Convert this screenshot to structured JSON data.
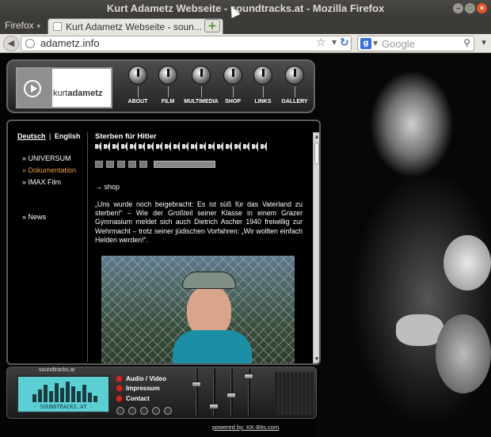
{
  "window": {
    "title": "Kurt Adametz Webseite - soundtracks.at - Mozilla Firefox",
    "min_glyph": "–",
    "max_glyph": "□",
    "close_glyph": "×"
  },
  "browser": {
    "menu_label": "Firefox",
    "tab_title": "Kurt Adametz Webseite - soun...",
    "url": "adametz.info",
    "search_placeholder": "Google",
    "search_engine": "Google"
  },
  "site": {
    "logo_text_light": "kurt",
    "logo_text_bold": "adametz",
    "nav": [
      {
        "label": "ABOUT"
      },
      {
        "label": "FILM"
      },
      {
        "label": "MULTIMEDIA"
      },
      {
        "label": "SHOP"
      },
      {
        "label": "LINKS"
      },
      {
        "label": "GALLERY"
      }
    ],
    "languages": {
      "de": "Deutsch",
      "separator": "|",
      "en": "English"
    },
    "sidebar": [
      {
        "label": "» UNIVERSUM",
        "active": false
      },
      {
        "label": "» Dokumentation",
        "active": true
      },
      {
        "label": "» IMAX Film",
        "active": false
      },
      {
        "label": "» News",
        "active": false
      }
    ],
    "article": {
      "title": "Sterben für Hitler",
      "shop_link": "→ shop",
      "quote": "„Uns wurde noch beigebracht: Es ist süß für das Vaterland zu sterben!“ – Wie der Großteil seiner Klasse in einem Grazer Gymnasium meldet sich auch Dietrich Ascher 1940 freiwillig zur Wehrmacht – trotz seiner jüdischen Vorfahren: „Wir wollten einfach Helden werden!“."
    },
    "mixer": {
      "lcd_label": "soundtracks.at",
      "lcd_brand": "- SOUNDTRACKS.AT -",
      "links": [
        {
          "label": "Audio / Video"
        },
        {
          "label": "Impressum"
        },
        {
          "label": "Contact"
        }
      ]
    },
    "footer": "powered by: KK-Bits.com"
  },
  "colors": {
    "accent_active": "#e8a04a",
    "led": "#d02a1e",
    "lcd": "#5bcfd3"
  }
}
